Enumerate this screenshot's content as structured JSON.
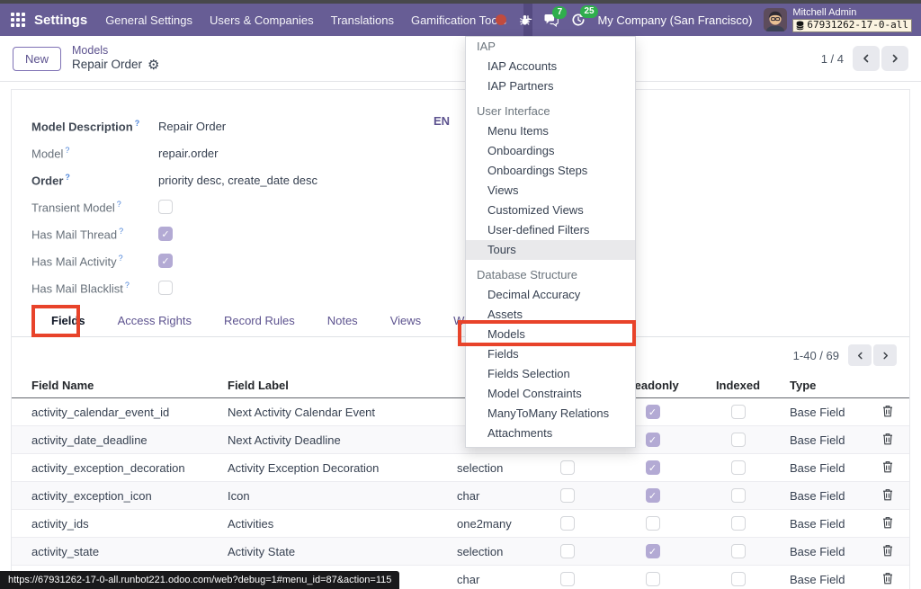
{
  "colors": {
    "navbar": "#675d95",
    "annotation": "#e8432a",
    "badge_green": "#2fae4d",
    "record_dot": "#c14b3e",
    "link_purple": "#5d538f",
    "checkbox_checked": "#b3aad4"
  },
  "topbar": {
    "app_name": "Settings",
    "menus": [
      "General Settings",
      "Users & Companies",
      "Translations",
      "Gamification Tools"
    ],
    "plus_label": "+",
    "chat_badge": "7",
    "activity_badge": "25",
    "company": "My Company (San Francisco)",
    "user_name": "Mitchell Admin",
    "database": "67931262-17-0-all"
  },
  "control_panel": {
    "new_label": "New",
    "breadcrumb_parent": "Models",
    "breadcrumb_current": "Repair Order",
    "pager": "1 / 4"
  },
  "form": {
    "lang_badge": "EN",
    "help_marker": "?",
    "rows": [
      {
        "label": "Model Description",
        "value": "Repair Order",
        "bold": true
      },
      {
        "label": "Model",
        "value": "repair.order",
        "bold": false
      },
      {
        "label": "Order",
        "value": "priority desc, create_date desc",
        "bold": true
      },
      {
        "label": "Transient Model",
        "checked": false
      },
      {
        "label": "Has Mail Thread",
        "checked": true
      },
      {
        "label": "Has Mail Activity",
        "checked": true
      },
      {
        "label": "Has Mail Blacklist",
        "checked": false
      }
    ]
  },
  "tabs": [
    "Fields",
    "Access Rights",
    "Record Rules",
    "Notes",
    "Views",
    "Website Forms"
  ],
  "active_tab": "Fields",
  "list": {
    "pager": "1-40 / 69",
    "columns": [
      "Field Name",
      "Field Label",
      "",
      "",
      "Readonly",
      "Indexed",
      "Type",
      ""
    ],
    "rows": [
      {
        "name": "activity_calendar_event_id",
        "label": "Next Activity Calendar Event",
        "ftype": "",
        "required": null,
        "readonly": true,
        "indexed": false,
        "type": "Base Field"
      },
      {
        "name": "activity_date_deadline",
        "label": "Next Activity Deadline",
        "ftype": "",
        "required": null,
        "readonly": true,
        "indexed": false,
        "type": "Base Field"
      },
      {
        "name": "activity_exception_decoration",
        "label": "Activity Exception Decoration",
        "ftype": "selection",
        "required": false,
        "readonly": true,
        "indexed": false,
        "type": "Base Field"
      },
      {
        "name": "activity_exception_icon",
        "label": "Icon",
        "ftype": "char",
        "required": false,
        "readonly": true,
        "indexed": false,
        "type": "Base Field"
      },
      {
        "name": "activity_ids",
        "label": "Activities",
        "ftype": "one2many",
        "required": false,
        "readonly": false,
        "indexed": false,
        "type": "Base Field"
      },
      {
        "name": "activity_state",
        "label": "Activity State",
        "ftype": "selection",
        "required": false,
        "readonly": true,
        "indexed": false,
        "type": "Base Field"
      },
      {
        "name": "",
        "label": "",
        "ftype": "char",
        "required": false,
        "readonly": false,
        "indexed": false,
        "type": "Base Field"
      }
    ]
  },
  "technical_menu": {
    "sections": [
      {
        "title": "IAP",
        "items": [
          "IAP Accounts",
          "IAP Partners"
        ]
      },
      {
        "title": "User Interface",
        "items": [
          "Menu Items",
          "Onboardings",
          "Onboardings Steps",
          "Views",
          "Customized Views",
          "User-defined Filters",
          "Tours"
        ]
      },
      {
        "title": "Database Structure",
        "items": [
          "Decimal Accuracy",
          "Assets",
          "Models",
          "Fields",
          "Fields Selection",
          "Model Constraints",
          "ManyToMany Relations",
          "Attachments"
        ]
      }
    ],
    "hovered_item": "Tours",
    "annotated_item": "Models"
  },
  "status_url": "https://67931262-17-0-all.runbot221.odoo.com/web?debug=1#menu_id=87&action=115"
}
